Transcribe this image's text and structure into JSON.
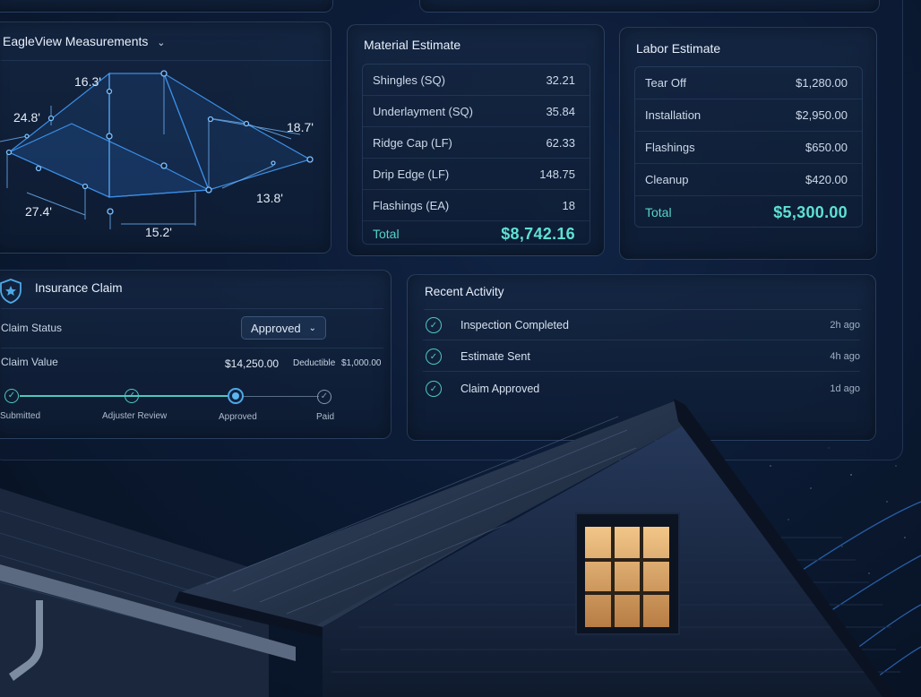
{
  "measurements": {
    "title": "EagleView Measurements",
    "labels": [
      "16.3'",
      "24.8'",
      "18.7'",
      "13.8'",
      "27.4'",
      "15.2'"
    ]
  },
  "material": {
    "title": "Material Estimate",
    "rows": [
      {
        "name": "Shingles (SQ)",
        "value": "32.21"
      },
      {
        "name": "Underlayment (SQ)",
        "value": "35.84"
      },
      {
        "name": "Ridge Cap (LF)",
        "value": "62.33"
      },
      {
        "name": "Drip Edge (LF)",
        "value": "148.75"
      },
      {
        "name": "Flashings (EA)",
        "value": "18"
      }
    ],
    "total_label": "Total",
    "total_value": "$8,742.16"
  },
  "labor": {
    "title": "Labor Estimate",
    "rows": [
      {
        "name": "Tear Off",
        "value": "$1,280.00"
      },
      {
        "name": "Installation",
        "value": "$2,950.00"
      },
      {
        "name": "Flashings",
        "value": "$650.00"
      },
      {
        "name": "Cleanup",
        "value": "$420.00"
      }
    ],
    "total_label": "Total",
    "total_value": "$5,300.00"
  },
  "claim": {
    "title": "Insurance Claim",
    "status_label": "Claim Status",
    "status_value": "Approved",
    "value_label": "Claim Value",
    "value_amount": "$14,250.00",
    "deductible_label": "Deductible",
    "deductible_amount": "$1,000.00",
    "steps": [
      "Submitted",
      "Adjuster Review",
      "Approved",
      "Paid"
    ]
  },
  "activity": {
    "title": "Recent Activity",
    "items": [
      {
        "label": "Inspection Completed",
        "time": "2h ago"
      },
      {
        "label": "Estimate Sent",
        "time": "4h ago"
      },
      {
        "label": "Claim Approved",
        "time": "1d ago"
      }
    ]
  },
  "colors": {
    "accent": "#4fc8bd",
    "window_light": "#e9b777"
  }
}
